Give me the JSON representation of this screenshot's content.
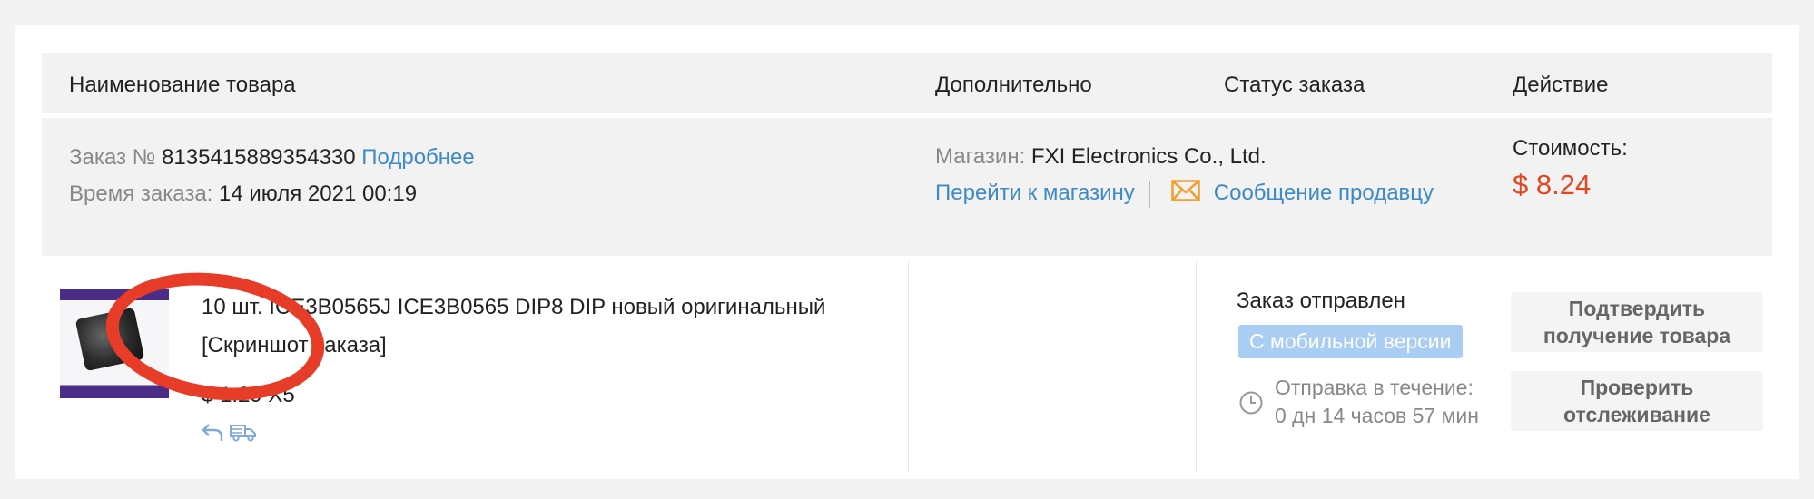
{
  "table_header": {
    "product_name": "Наименование товара",
    "additional": "Дополнительно",
    "order_status": "Статус заказа",
    "action": "Действие"
  },
  "order": {
    "number_label": "Заказ №",
    "number": "8135415889354330",
    "details_link": "Подробнее",
    "time_label": "Время заказа:",
    "time": "14 июля 2021 00:19",
    "store_label": "Магазин:",
    "store_name": "FXI Electronics Co., Ltd.",
    "go_to_store": "Перейти к магазину",
    "message_seller": "Сообщение продавцу",
    "cost_label": "Стоимость:",
    "cost": "$ 8.24"
  },
  "item": {
    "name": "10 шт. ICE3B0565J ICE3B0565 DIP8 DIP новый оригинальный",
    "screenshot_label": "[Скриншот заказа]",
    "unit_price": "$ 1.29 X5",
    "icons": [
      "return-icon",
      "delivery-truck-icon"
    ]
  },
  "status": {
    "text": "Заказ отправлен",
    "badge": "С мобильной версии",
    "ship_line1": "Отправка в течение:",
    "ship_line2": "0 дн 14 часов 57 мин"
  },
  "actions": {
    "confirm_line1": "Подтвердить",
    "confirm_line2": "получение товара",
    "track_line1": "Проверить",
    "track_line2": "отслеживание"
  },
  "colors": {
    "link": "#3d8ac6",
    "price": "#e0461f",
    "badge": "#a9cdf3",
    "annotation": "#e63c28",
    "mail_icon": "#f0a030"
  }
}
